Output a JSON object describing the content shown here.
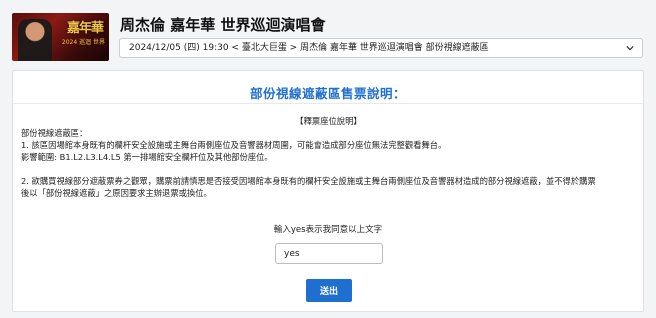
{
  "header": {
    "thumbnail_text": [
      "嘉年華",
      "2024 巡迴 世界"
    ],
    "title": "周杰倫 嘉年華 世界巡迴演唱會",
    "session": "2024/12/05 (四) 19:30 < 臺北大巨蛋 > 周杰倫 嘉年華 世界巡迴演唱會 部份視線遮蔽區",
    "chevron_icon": "chevron-down-icon"
  },
  "notice": {
    "title": "部份視線遮蔽區售票說明：",
    "section_heading": "【釋票座位說明】",
    "lines": [
      "部份視線遮蔽區：",
      "1. 該區因場館本身既有的欄杆安全設施或主舞台兩側座位及音響器材周圍，可能會造成部分座位無法完整觀看舞台。",
      "影響範圍: B1.L2.L3.L4.L5 第一排場館安全欄杆位及其他部份座位。"
    ],
    "lines2": [
      "2. 欲購買視線部分遮蔽票券之觀眾，購票前請慎思是否接受因場館本身既有的欄杆安全設施或主舞台兩側座位及音響器材造成的部分視線遮蔽，並不得於購票",
      "後以「部份視線遮蔽」之原因要求主辦退票或換位。"
    ]
  },
  "confirm": {
    "prompt": "輸入yes表示我同意以上文字",
    "value": "yes",
    "submit_label": "送出"
  },
  "colors": {
    "accent": "#1f6fd1",
    "background": "#f3f4f6",
    "card": "#ffffff"
  }
}
